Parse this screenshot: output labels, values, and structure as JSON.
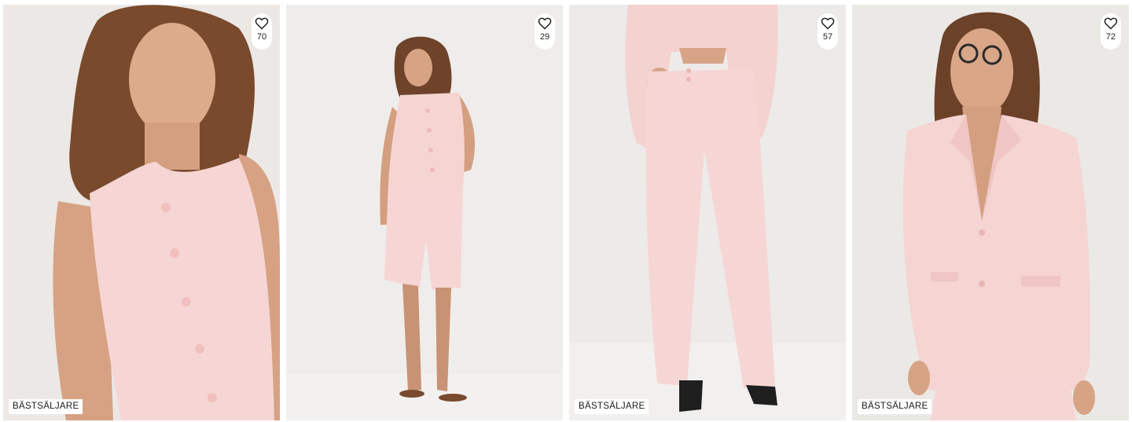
{
  "products": [
    {
      "favorites": "70",
      "badge": "BÄSTSÄLJARE"
    },
    {
      "favorites": "29",
      "badge": ""
    },
    {
      "favorites": "57",
      "badge": "BÄSTSÄLJARE"
    },
    {
      "favorites": "72",
      "badge": "BÄSTSÄLJARE"
    }
  ],
  "icons": {
    "favorite": "heart-outline-icon"
  },
  "colors": {
    "garment": "#f6d5d3",
    "background": "#eeecea",
    "skin": "#d9a688",
    "hair": "#6b4128"
  }
}
